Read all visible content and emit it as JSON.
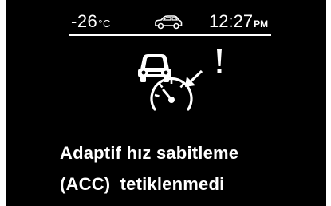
{
  "status_bar": {
    "temperature_value": "-26",
    "temperature_unit": "°C",
    "clock_time": "12:27",
    "clock_period": "PM",
    "vehicle_icon": "car-outline-icon"
  },
  "warning": {
    "icon": "acc-distance-speedometer-warning-icon",
    "message_line1": "Adaptif hız sabitleme",
    "message_line2": "(ACC)  tetiklenmedi"
  },
  "colors": {
    "screen_background": "#000000",
    "foreground": "#ffffff",
    "page_background": "#ffffff"
  }
}
